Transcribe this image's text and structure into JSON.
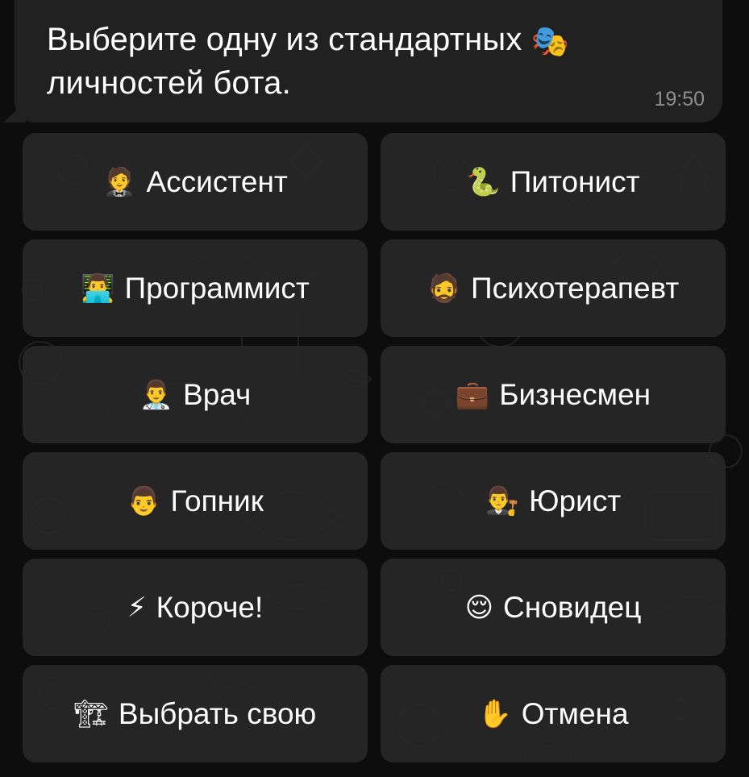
{
  "message": {
    "text": "Выберите одну из стандартных",
    "text_line2": "личностей бота.",
    "emoji": "🎭",
    "time": "19:50"
  },
  "keyboard": {
    "buttons": [
      {
        "emoji": "🤵",
        "label": "Ассистент"
      },
      {
        "emoji": "🐍",
        "label": "Питонист"
      },
      {
        "emoji": "👨‍💻",
        "label": "Программист"
      },
      {
        "emoji": "🧔",
        "label": "Психотерапевт"
      },
      {
        "emoji": "👨‍⚕️",
        "label": "Врач"
      },
      {
        "emoji": "💼",
        "label": "Бизнесмен"
      },
      {
        "emoji": "👨",
        "label": "Гопник"
      },
      {
        "emoji": "👨‍⚖️",
        "label": "Юрист"
      },
      {
        "emoji": "⚡",
        "label": "Короче!"
      },
      {
        "emoji": "😌",
        "label": "Сновидец"
      },
      {
        "emoji": "🏗",
        "label": "Выбрать свою"
      },
      {
        "emoji": "✋",
        "label": "Отмена"
      }
    ]
  },
  "colors": {
    "background": "#0d0d0e",
    "bubble": "#212121",
    "button": "#282828",
    "text": "#ffffff",
    "time": "#8e8e8e"
  }
}
